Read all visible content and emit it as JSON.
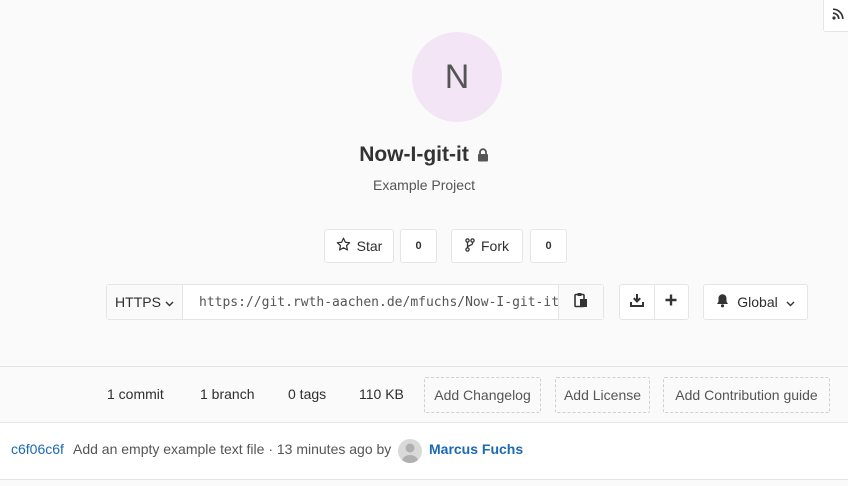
{
  "project": {
    "avatar_letter": "N",
    "name": "Now-I-git-it",
    "description": "Example Project"
  },
  "actions": {
    "star_label": "Star",
    "star_count": "0",
    "fork_label": "Fork",
    "fork_count": "0"
  },
  "clone": {
    "protocol": "HTTPS",
    "url": "https://git.rwth-aachen.de/mfuchs/Now-I-git-it.git"
  },
  "notifications": {
    "level": "Global"
  },
  "stats": {
    "commits": "1 commit",
    "branches": "1 branch",
    "tags": "0 tags",
    "size": "110 KB",
    "add_changelog": "Add Changelog",
    "add_license": "Add License",
    "add_contribution": "Add Contribution guide"
  },
  "last_commit": {
    "sha": "c6f06c6f",
    "message": "Add an empty example text file · 13 minutes ago by",
    "author": "Marcus Fuchs"
  },
  "icons": [
    "rss-icon",
    "lock-icon",
    "star-icon",
    "fork-icon",
    "chevron-down-icon",
    "clipboard-icon",
    "download-icon",
    "plus-icon",
    "bell-icon"
  ]
}
